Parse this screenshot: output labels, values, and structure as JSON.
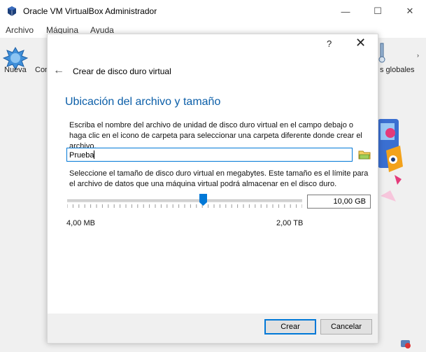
{
  "window": {
    "title": "Oracle VM VirtualBox Administrador",
    "minimize_label": "—",
    "maximize_label": "☐",
    "close_label": "✕"
  },
  "menu": {
    "items": [
      "Archivo",
      "Máquina",
      "Ayuda"
    ]
  },
  "toolbar": {
    "new_label": "Nueva",
    "con_label": "Con",
    "globales_label": "s globales",
    "right_arrow": "›"
  },
  "dialog": {
    "help_label": "?",
    "close_label": "✕",
    "back_label": "←",
    "heading": "Crear de disco duro virtual",
    "section_title": "Ubicación del archivo y tamaño",
    "description1": "Escriba el nombre del archivo de unidad de disco duro virtual en el campo debajo o haga clic en el icono de carpeta para seleccionar una carpeta diferente donde crear el archivo.",
    "file_name": "Prueba",
    "description2": "Seleccione el tamaño de disco duro virtual en megabytes. Este tamaño es el límite para el archivo de datos que una máquina virtual podrá almacenar en el disco duro.",
    "size_value": "10,00 GB",
    "range_min": "4,00 MB",
    "range_max": "2,00 TB",
    "slider_fraction": 0.58,
    "create_label": "Crear",
    "cancel_label": "Cancelar"
  },
  "colors": {
    "accent": "#0078d7",
    "section_title": "#0b5ea8"
  },
  "icons": [
    "virtualbox-icon",
    "new-vm-icon",
    "folder-icon",
    "global-tools-icon",
    "vm-status-icon"
  ]
}
